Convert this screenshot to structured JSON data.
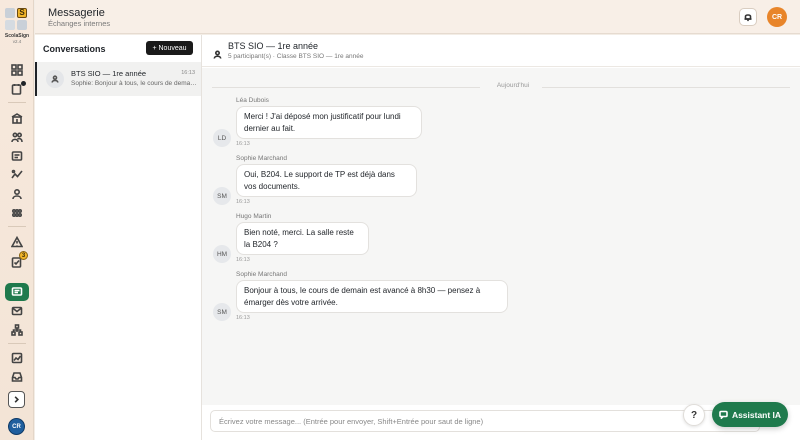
{
  "app": {
    "brand": "ScolaSign",
    "version": "v2.4",
    "logo_letter": "S"
  },
  "header": {
    "title": "Messagerie",
    "subtitle": "Échanges internes",
    "user_initials": "CR"
  },
  "rail": {
    "icons": [
      "dashboard-icon",
      "calendar-icon",
      "school-icon",
      "users-group-icon",
      "id-card-icon",
      "activity-icon",
      "user-icon",
      "grid-icon",
      "warning-icon",
      "document-check-icon",
      "messages-icon",
      "mail-icon",
      "org-chart-icon",
      "chart-icon",
      "inbox-icon"
    ],
    "badge_count": "3",
    "user_initials": "CR"
  },
  "conversations": {
    "title": "Conversations",
    "new_label": "+ Nouveau",
    "items": [
      {
        "name": "BTS SIO — 1re année",
        "time": "16:13",
        "preview": "Sophie: Bonjour à tous, le cours de demain est avancé à 8h30 — pensez à émarger dès votre arrivée."
      }
    ]
  },
  "chat": {
    "title": "BTS SIO — 1re année",
    "meta": "5 participant(s) · Classe BTS SIO — 1re année",
    "day_label": "Aujourd'hui",
    "messages": [
      {
        "author": "Léa Dubois",
        "initials": "LD",
        "text": "Merci ! J'ai déposé mon justificatif pour lundi dernier au fait.",
        "time": "16:13"
      },
      {
        "author": "Sophie Marchand",
        "initials": "SM",
        "text": "Oui, B204. Le support de TP est déjà dans vos documents.",
        "time": "16:13"
      },
      {
        "author": "Hugo Martin",
        "initials": "HM",
        "text": "Bien noté, merci. La salle reste la B204 ?",
        "time": "16:13"
      },
      {
        "author": "Sophie Marchand",
        "initials": "SM",
        "text": "Bonjour à tous, le cours de demain est avancé à 8h30 — pensez à émarger dès votre arrivée.",
        "time": "16:13"
      }
    ],
    "composer_placeholder": "Écrivez votre message... (Entrée pour envoyer, Shift+Entrée pour saut de ligne)"
  },
  "help": {
    "label": "?"
  },
  "assistant": {
    "label": "Assistant IA"
  },
  "colors": {
    "accent": "#1f7a4d",
    "avatar_orange": "#e8852a",
    "avatar_blue": "#1f5f9e",
    "badge": "#f0b429"
  }
}
